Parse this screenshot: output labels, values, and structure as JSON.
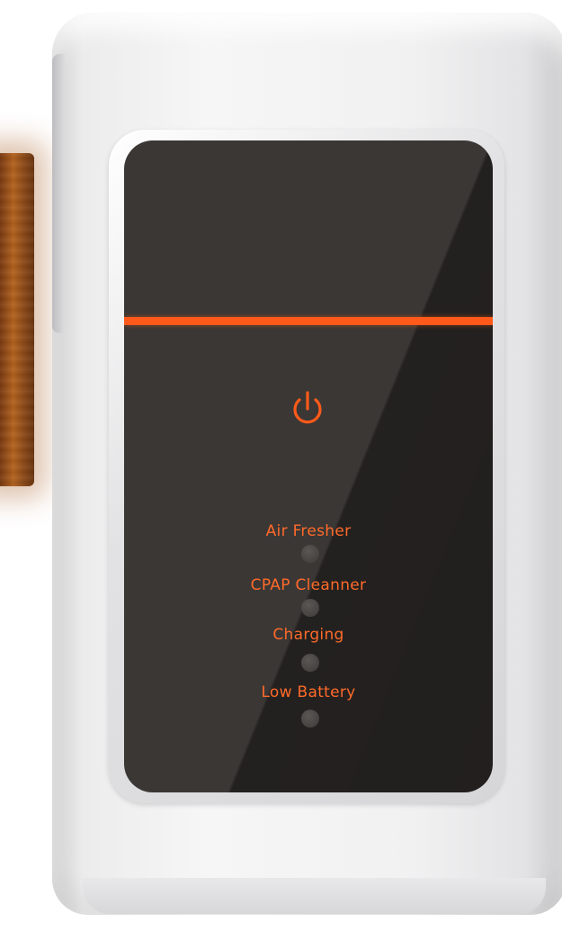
{
  "panel": {
    "indicators": [
      {
        "label": "Air Fresher"
      },
      {
        "label": "CPAP Cleanner"
      },
      {
        "label": "Charging"
      },
      {
        "label": "Low Battery"
      }
    ]
  },
  "icons": {
    "power": "power-icon"
  },
  "colors": {
    "accent": "#ff5a1a",
    "label": "#ff6a2a",
    "screen": "#2b2826",
    "body": "#f1f1f2"
  }
}
